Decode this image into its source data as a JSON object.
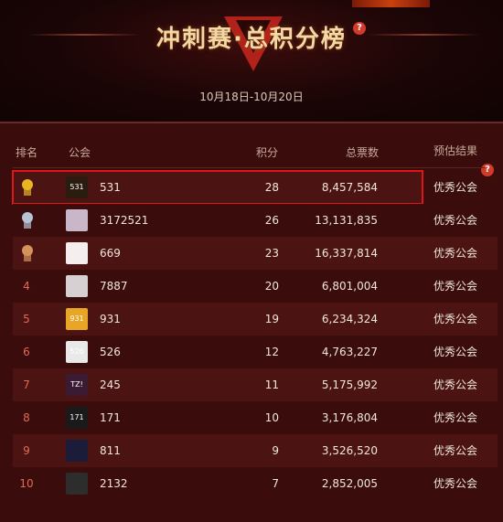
{
  "header": {
    "title": "冲刺赛·总积分榜",
    "help_glyph": "?",
    "date_range": "10月18日-10月20日"
  },
  "table": {
    "columns": [
      "排名",
      "公会",
      "积分",
      "总票数",
      "预估结果"
    ],
    "rows": [
      {
        "rank": "1",
        "medal": "gold",
        "guild": "531",
        "points": "28",
        "votes": "8,457,584",
        "result": "优秀公会",
        "avatar_color": "#2a1d10",
        "avatar_text": "531",
        "highlighted": true
      },
      {
        "rank": "2",
        "medal": "silver",
        "guild": "3172521",
        "points": "26",
        "votes": "13,131,835",
        "result": "优秀公会",
        "avatar_color": "#c9b7c9",
        "avatar_text": ""
      },
      {
        "rank": "3",
        "medal": "bronze",
        "guild": "669",
        "points": "23",
        "votes": "16,337,814",
        "result": "优秀公会",
        "avatar_color": "#f4eeee",
        "avatar_text": ""
      },
      {
        "rank": "4",
        "medal": "",
        "guild": "7887",
        "points": "20",
        "votes": "6,801,004",
        "result": "优秀公会",
        "avatar_color": "#d6d0d2",
        "avatar_text": ""
      },
      {
        "rank": "5",
        "medal": "",
        "guild": "931",
        "points": "19",
        "votes": "6,234,324",
        "result": "优秀公会",
        "avatar_color": "#e8a526",
        "avatar_text": "931"
      },
      {
        "rank": "6",
        "medal": "",
        "guild": "526",
        "points": "12",
        "votes": "4,763,227",
        "result": "优秀公会",
        "avatar_color": "#e9e9e9",
        "avatar_text": "526"
      },
      {
        "rank": "7",
        "medal": "",
        "guild": "245",
        "points": "11",
        "votes": "5,175,992",
        "result": "优秀公会",
        "avatar_color": "#3b1a33",
        "avatar_text": "TZ!"
      },
      {
        "rank": "8",
        "medal": "",
        "guild": "171",
        "points": "10",
        "votes": "3,176,804",
        "result": "优秀公会",
        "avatar_color": "#1a1a1a",
        "avatar_text": "171"
      },
      {
        "rank": "9",
        "medal": "",
        "guild": "811",
        "points": "9",
        "votes": "3,526,520",
        "result": "优秀公会",
        "avatar_color": "#1a1c3a",
        "avatar_text": ""
      },
      {
        "rank": "10",
        "medal": "",
        "guild": "2132",
        "points": "7",
        "votes": "2,852,005",
        "result": "优秀公会",
        "avatar_color": "#2d2d2d",
        "avatar_text": ""
      }
    ]
  },
  "colors": {
    "accent": "#e0151a",
    "rank_text": "#e26a55",
    "gold": "#e8b423",
    "silver": "#b8c3d6",
    "bronze": "#d4935a"
  }
}
